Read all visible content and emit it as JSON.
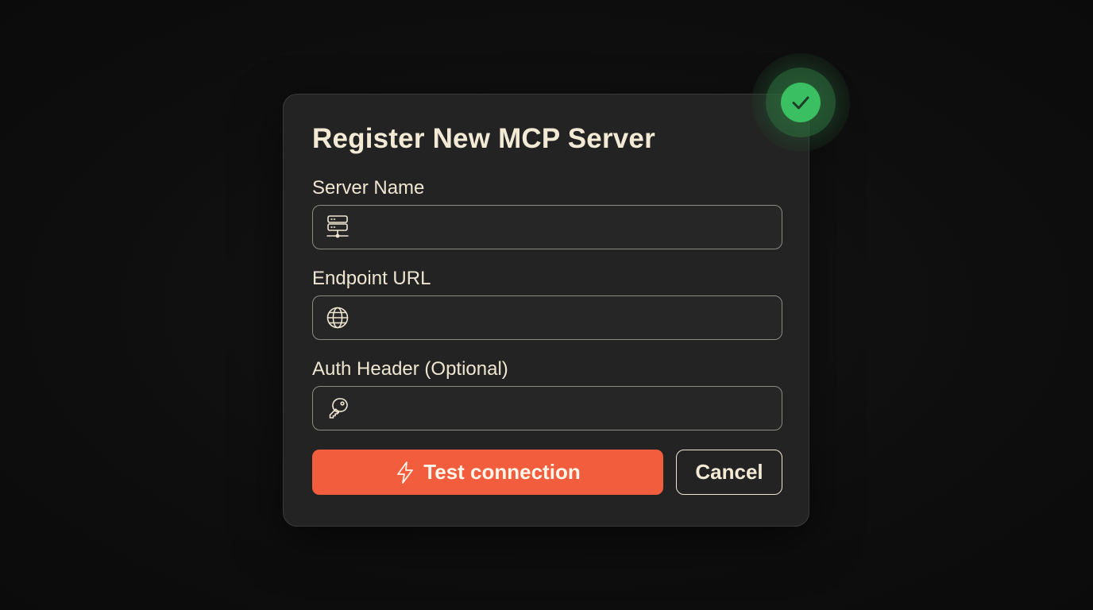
{
  "dialog": {
    "title": "Register New MCP Server",
    "fields": [
      {
        "label": "Server Name",
        "value": "",
        "placeholder": "",
        "icon": "server-icon"
      },
      {
        "label": "Endpoint URL",
        "value": "",
        "placeholder": "",
        "icon": "globe-icon"
      },
      {
        "label": "Auth Header (Optional)",
        "value": "",
        "placeholder": "",
        "icon": "key-icon"
      }
    ],
    "primary_button": {
      "label": "Test connection",
      "icon": "lightning-bolt-icon",
      "color": "#f15d3d"
    },
    "secondary_button": {
      "label": "Cancel"
    }
  },
  "status_badge": {
    "icon": "checkmark-icon",
    "color": "#3bbf63"
  },
  "colors": {
    "background": "#0f0f0f",
    "dialog": "#232323",
    "text": "#f3ead6",
    "accent": "#f15d3d",
    "success": "#3bbf63"
  }
}
